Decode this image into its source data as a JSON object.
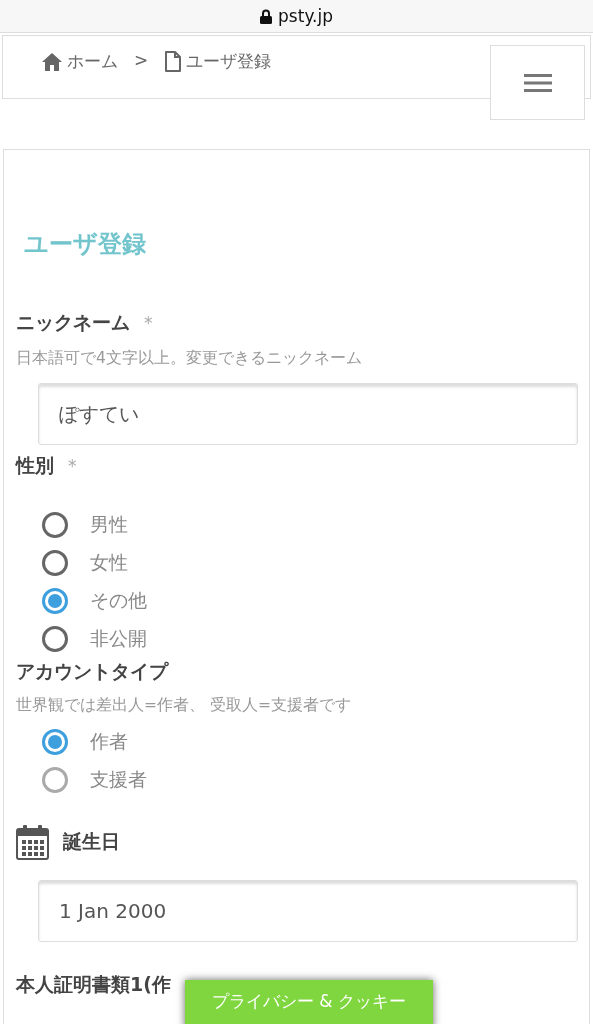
{
  "address_bar": {
    "url": "psty.jp"
  },
  "breadcrumb": [
    {
      "kind": "home",
      "label": "ホーム"
    },
    {
      "kind": "separator",
      "label": ">"
    },
    {
      "kind": "page",
      "label": "ユーザ登録"
    }
  ],
  "page_title": "ユーザ登録",
  "nickname": {
    "label": "ニックネーム",
    "required_mark": "*",
    "hint": "日本語可で4文字以上。変更できるニックネーム",
    "value": "ぽすてい"
  },
  "gender": {
    "label": "性別",
    "required_mark": "*",
    "options": [
      {
        "label": "男性",
        "selected": false
      },
      {
        "label": "女性",
        "selected": false
      },
      {
        "label": "その他",
        "selected": true
      },
      {
        "label": "非公開",
        "selected": false
      }
    ]
  },
  "account_type": {
    "label": "アカウントタイプ",
    "hint": "世界観では差出人=作者、 受取人=支援者です",
    "options": [
      {
        "label": "作者",
        "selected": true,
        "disabled": false
      },
      {
        "label": "支援者",
        "selected": false,
        "disabled": true
      }
    ]
  },
  "birthday": {
    "label": "誕生日",
    "value": "1 Jan 2000"
  },
  "id_document": {
    "label": "本人証明書類1(作"
  },
  "cookie_button": "プライバシー & クッキー"
}
